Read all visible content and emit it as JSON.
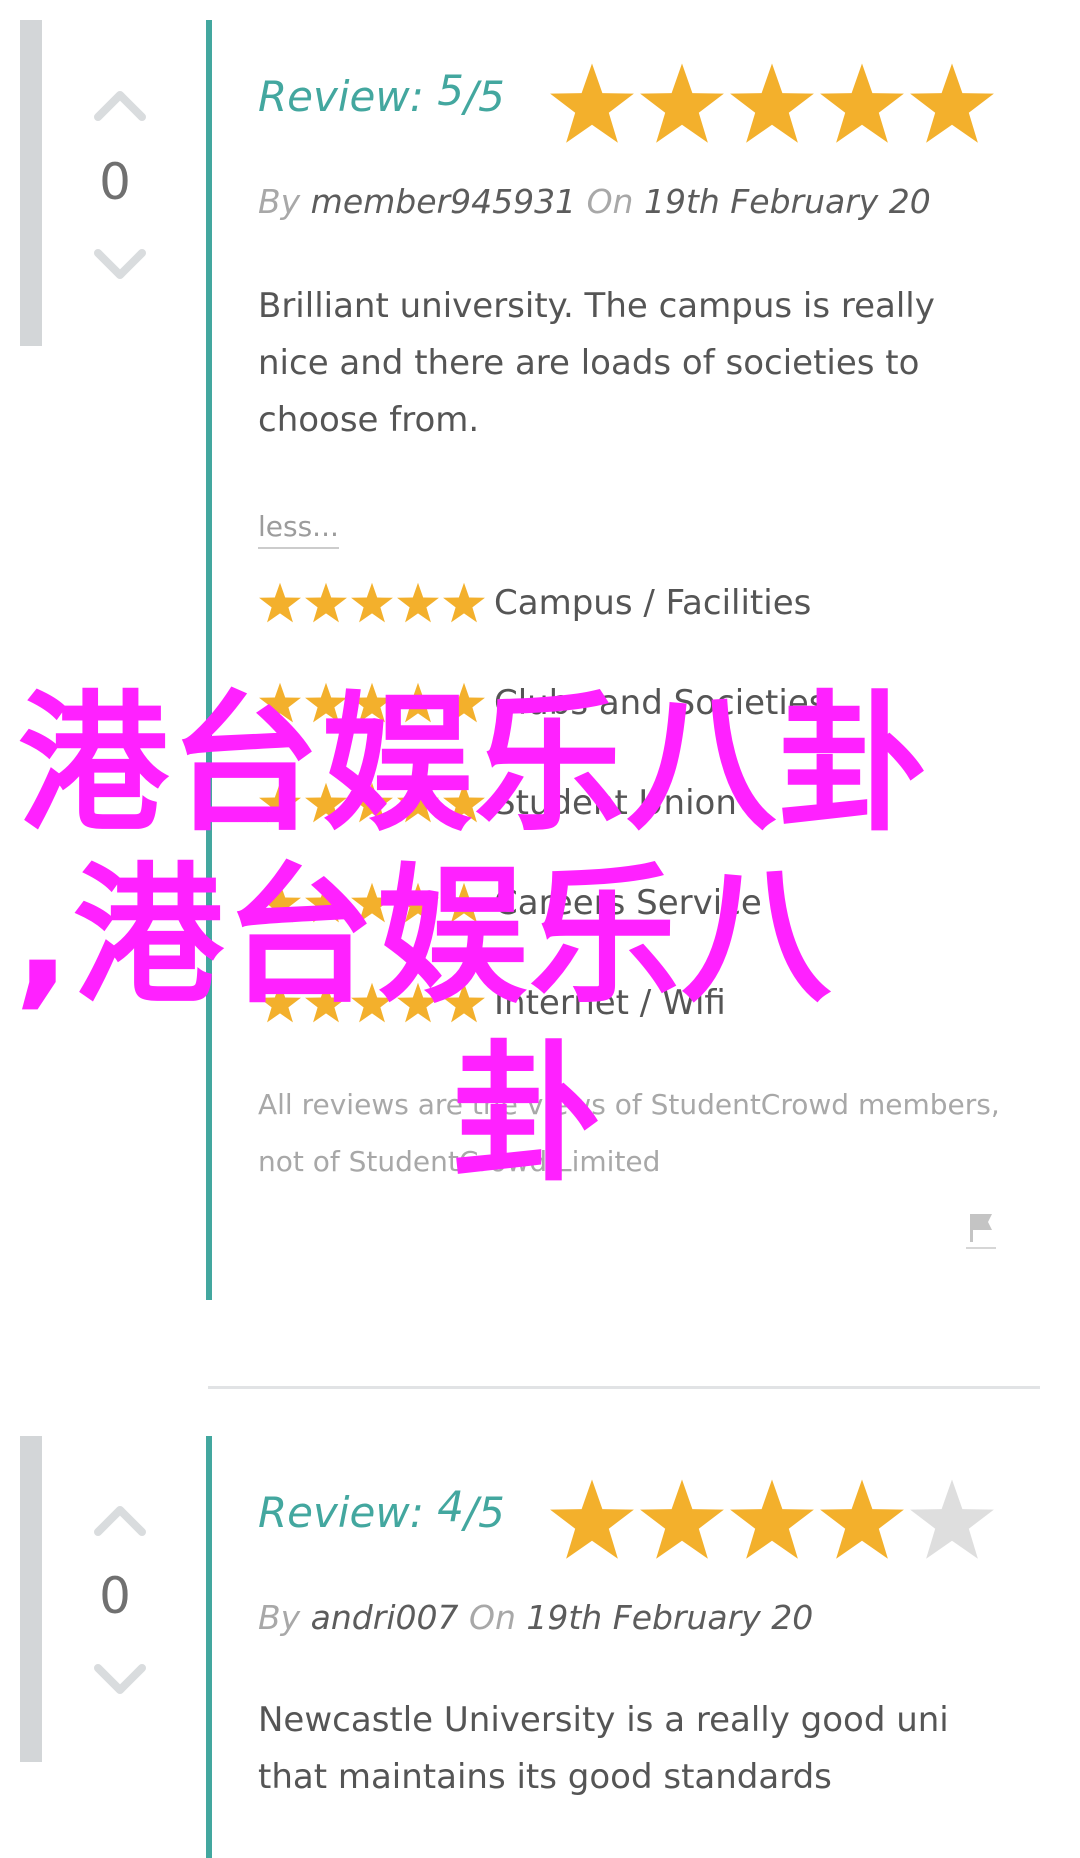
{
  "reviews": [
    {
      "votes": "0",
      "review_label": "Review:",
      "score": "5",
      "out_of": "5",
      "rating": 5,
      "by_label": "By",
      "author": "member945931",
      "on_label": "On",
      "date": "19th February 20",
      "text": "Brilliant university. The campus is really nice and there are loads of societies to choose from.",
      "less_link": "less...",
      "categories": [
        {
          "label": "Campus / Facilities",
          "rating": 5
        },
        {
          "label": "Clubs and Societies",
          "rating": 5
        },
        {
          "label": "Student Union",
          "rating": 5
        },
        {
          "label": "Careers Service",
          "rating": 5
        },
        {
          "label": "Internet / Wifi",
          "rating": 5
        }
      ],
      "disclaimer": "All reviews are the views of StudentCrowd members, not of StudentCrowd Limited"
    },
    {
      "votes": "0",
      "review_label": "Review:",
      "score": "4",
      "out_of": "5",
      "rating": 4,
      "by_label": "By",
      "author": "andri007",
      "on_label": "On",
      "date": "19th February 20",
      "text": "Newcastle University is a really good uni that maintains its good standards"
    }
  ],
  "overlay": {
    "line1": "港台娱乐八卦",
    "line2": ",港台娱乐八",
    "line3": "卦"
  },
  "colors": {
    "teal": "#43a79f",
    "star_filled": "#f3b02c",
    "star_empty": "#dedede",
    "overlay": "#ff21ff"
  },
  "icons": [
    "chevron-up-icon",
    "chevron-down-icon",
    "star-icon",
    "flag-icon"
  ]
}
